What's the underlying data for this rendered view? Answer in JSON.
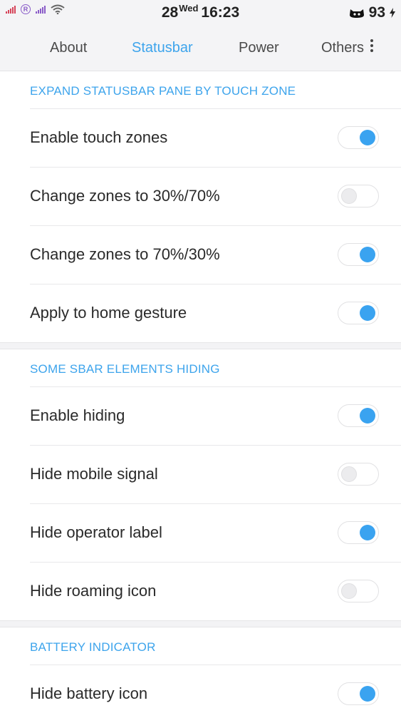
{
  "statusbar": {
    "date": "28",
    "weekday": "Wed",
    "time": "16:23",
    "battery": "93",
    "roaming_glyph": "R",
    "icons": [
      "signal-red-icon",
      "roaming-icon",
      "signal-purple-icon",
      "wifi-icon",
      "cat-icon",
      "charging-bolt-icon"
    ]
  },
  "tabs": [
    {
      "label": "About",
      "active": false
    },
    {
      "label": "Statusbar",
      "active": true
    },
    {
      "label": "Power",
      "active": false
    },
    {
      "label": "Others",
      "active": false
    }
  ],
  "colors": {
    "accent": "#3da4ec",
    "toggle_on": "#3aa3f0"
  },
  "sections": [
    {
      "title": "EXPAND STATUSBAR PANE BY TOUCH ZONE",
      "items": [
        {
          "label": "Enable touch zones",
          "enabled": true
        },
        {
          "label": "Change zones to 30%/70%",
          "enabled": false
        },
        {
          "label": "Change zones to 70%/30%",
          "enabled": true
        },
        {
          "label": "Apply to home gesture",
          "enabled": true
        }
      ]
    },
    {
      "title": "SOME SBAR ELEMENTS HIDING",
      "items": [
        {
          "label": "Enable hiding",
          "enabled": true
        },
        {
          "label": "Hide mobile signal",
          "enabled": false
        },
        {
          "label": "Hide operator label",
          "enabled": true
        },
        {
          "label": "Hide roaming icon",
          "enabled": false
        }
      ]
    },
    {
      "title": "BATTERY INDICATOR",
      "items": [
        {
          "label": "Hide battery icon",
          "enabled": true
        }
      ]
    }
  ]
}
